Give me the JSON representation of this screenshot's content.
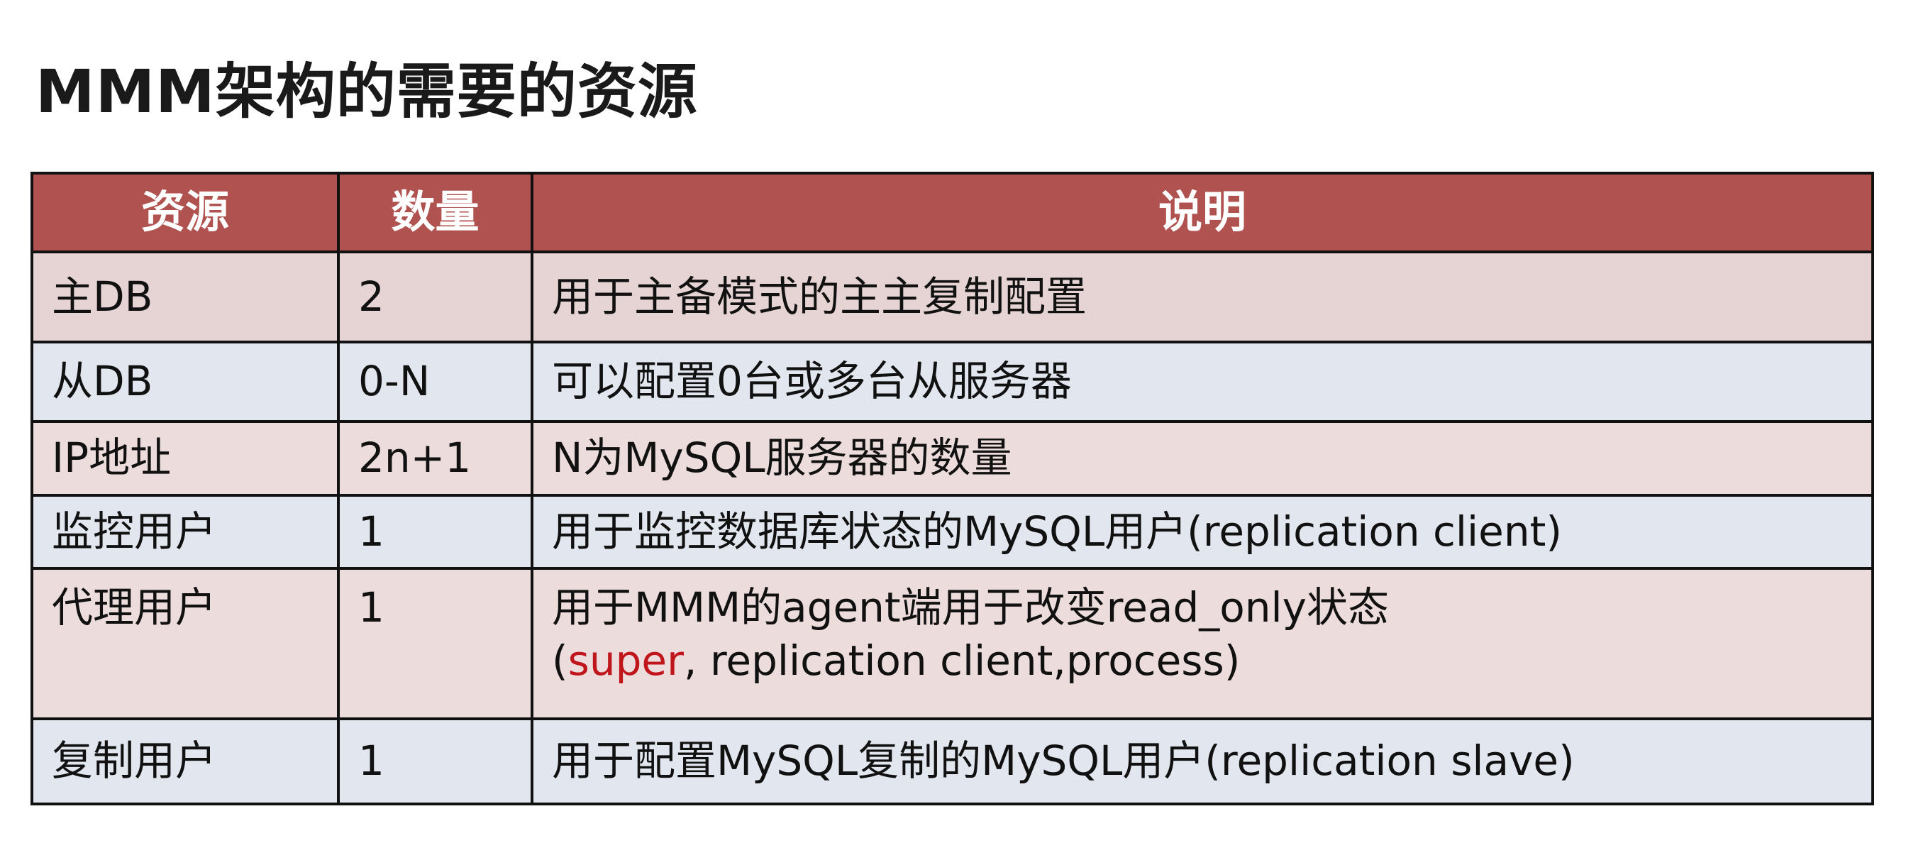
{
  "title": "MMM架构的需要的资源",
  "headers": [
    "资源",
    "数量",
    "说明"
  ],
  "rows": [
    {
      "resource": "主DB",
      "count": "2",
      "desc": "用于主备模式的主主复制配置"
    },
    {
      "resource": "从DB",
      "count": "0-N",
      "desc": "可以配置0台或多台从服务器"
    },
    {
      "resource": "IP地址",
      "count": "2n+1",
      "desc": "N为MySQL服务器的数量"
    },
    {
      "resource": "监控用户",
      "count": "1",
      "desc": "用于监控数据库状态的MySQL用户(replication client)"
    },
    {
      "resource": "代理用户",
      "count": "1",
      "desc": "用于MMM的agent端用于改变read_only状态",
      "desc2_open": "(",
      "desc2_highlight": "super",
      "desc2_rest": ", replication client,process)"
    },
    {
      "resource": "复制用户",
      "count": "1",
      "desc": "用于配置MySQL复制的MySQL用户(replication slave)"
    }
  ],
  "colors": {
    "header": "#b0524f",
    "row_pink": "#eddcdc",
    "row_blue": "#e2e6ef",
    "highlight": "#c0161b"
  }
}
